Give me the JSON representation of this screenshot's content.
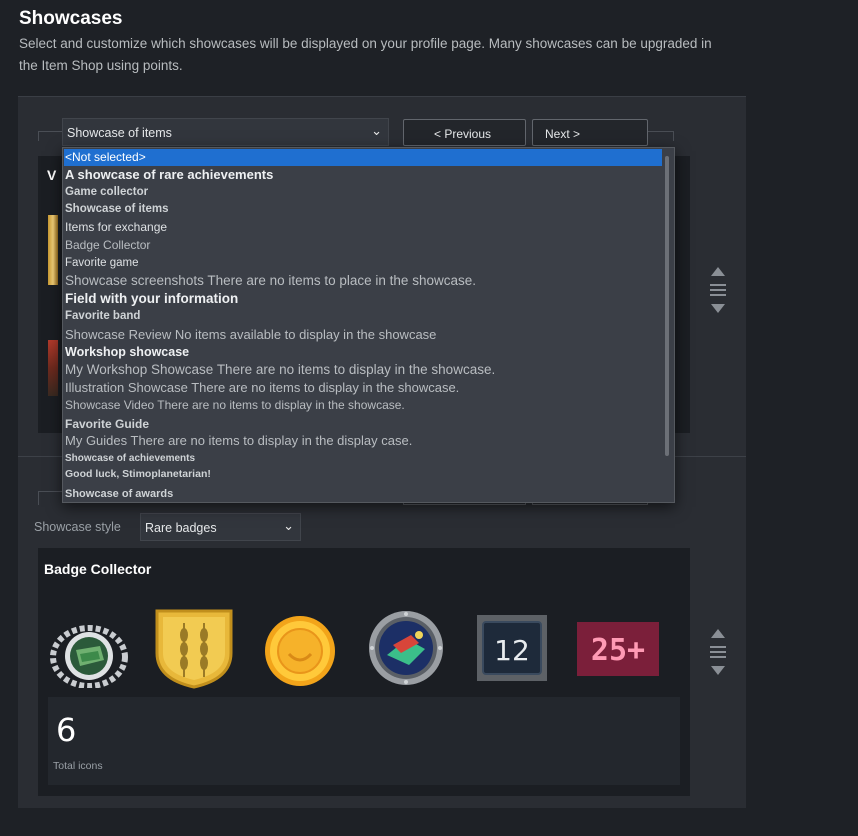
{
  "header": {
    "title": "Showcases",
    "description": "Select and customize which showcases will be displayed on your profile page. Many showcases can be upgraded in the Item Shop using points."
  },
  "top_showcase": {
    "select_value": "Showcase of items",
    "prev_label": "< Previous",
    "next_label": "Next >",
    "card_title_fragment": "V"
  },
  "dropdown": {
    "options": [
      "<Not selected>",
      "A showcase of rare achievements",
      "Game collector",
      "Showcase of items",
      "Items for exchange",
      "Badge Collector",
      "Favorite game",
      "Showcase screenshots There are no items to place in the showcase.",
      "Field with your information",
      "Favorite band",
      "Showcase Review No items available to display in the showcase",
      "Workshop showcase",
      "My Workshop Showcase There are no items to display in the showcase.",
      "Illustration Showcase There are no items to display in the showcase.",
      "Showcase Video There are no items to display in the showcase.",
      "Favorite Guide",
      "My Guides There are no items to display in the display case.",
      "Showcase of achievements",
      "Good luck, Stimoplanetarian!",
      "Showcase of awards"
    ]
  },
  "bottom_showcase": {
    "style_label": "Showcase style",
    "style_value": "Rare badges",
    "card_title": "Badge Collector",
    "badge_level_label": "12",
    "badge_plus_label": "25+",
    "count_value": "6",
    "count_label": "Total icons"
  },
  "colors": {
    "background": "#1e2126",
    "panel": "#2a2d33",
    "selected_option": "#1f6fd0"
  }
}
